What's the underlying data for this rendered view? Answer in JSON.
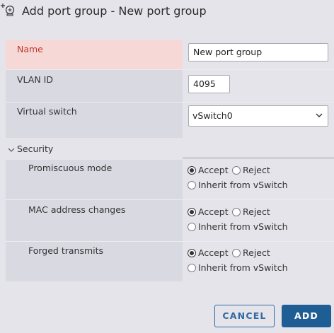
{
  "dialog": {
    "title": "Add port group - New port group",
    "title_icon": "add-port-group-icon"
  },
  "form": {
    "name": {
      "label": "Name",
      "value": "New port group",
      "state": "error",
      "error_color": "#c0392b"
    },
    "vlan_id": {
      "label": "VLAN ID",
      "value": "4095"
    },
    "virtual_switch": {
      "label": "Virtual switch",
      "value": "vSwitch0"
    }
  },
  "security": {
    "label": "Security",
    "expanded": true,
    "policies": [
      {
        "label": "Promiscuous mode",
        "options": [
          "Accept",
          "Reject",
          "Inherit from vSwitch"
        ],
        "selected": "Accept"
      },
      {
        "label": "MAC address changes",
        "options": [
          "Accept",
          "Reject",
          "Inherit from vSwitch"
        ],
        "selected": "Accept"
      },
      {
        "label": "Forged transmits",
        "options": [
          "Accept",
          "Reject",
          "Inherit from vSwitch"
        ],
        "selected": "Accept"
      }
    ]
  },
  "footer": {
    "cancel_label": "CANCEL",
    "add_label": "ADD",
    "accent": "#1f5e94"
  }
}
